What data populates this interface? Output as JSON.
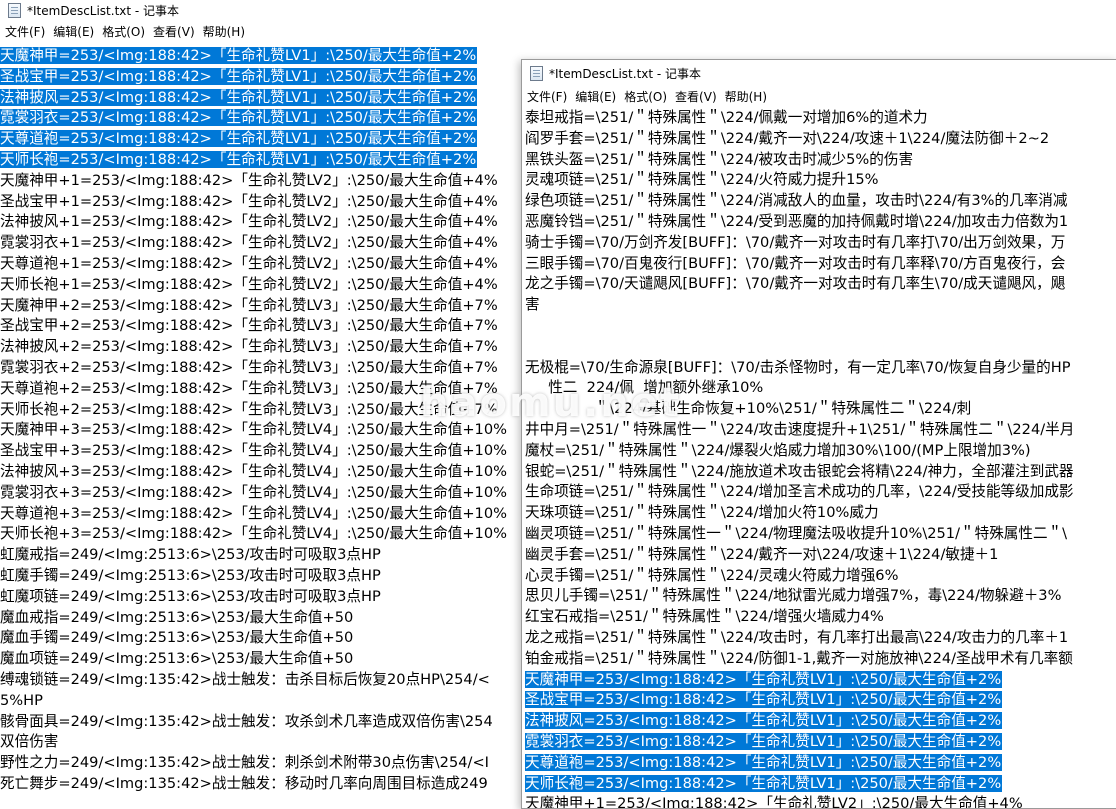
{
  "back_window": {
    "title": "*ItemDescList.txt - 记事本",
    "menu": [
      "文件(F)",
      "编辑(E)",
      "格式(O)",
      "查看(V)",
      "帮助(H)"
    ],
    "lines": [
      {
        "text": "天魔神甲=253/<Img:188:42>「生命礼赞LV1」:\\250/最大生命值+2%",
        "selected": true
      },
      {
        "text": "圣战宝甲=253/<Img:188:42>「生命礼赞LV1」:\\250/最大生命值+2%",
        "selected": true
      },
      {
        "text": "法神披风=253/<Img:188:42>「生命礼赞LV1」:\\250/最大生命值+2%",
        "selected": true
      },
      {
        "text": "霓裳羽衣=253/<Img:188:42>「生命礼赞LV1」:\\250/最大生命值+2%",
        "selected": true
      },
      {
        "text": "天尊道袍=253/<Img:188:42>「生命礼赞LV1」:\\250/最大生命值+2%",
        "selected": true
      },
      {
        "text": "天师长袍=253/<Img:188:42>「生命礼赞LV1」:\\250/最大生命值+2%",
        "selected": true
      },
      {
        "text": "天魔神甲+1=253/<Img:188:42>「生命礼赞LV2」:\\250/最大生命值+4%",
        "selected": false
      },
      {
        "text": "圣战宝甲+1=253/<Img:188:42>「生命礼赞LV2」:\\250/最大生命值+4%",
        "selected": false
      },
      {
        "text": "法神披风+1=253/<Img:188:42>「生命礼赞LV2」:\\250/最大生命值+4%",
        "selected": false
      },
      {
        "text": "霓裳羽衣+1=253/<Img:188:42>「生命礼赞LV2」:\\250/最大生命值+4%",
        "selected": false
      },
      {
        "text": "天尊道袍+1=253/<Img:188:42>「生命礼赞LV2」:\\250/最大生命值+4%",
        "selected": false
      },
      {
        "text": "天师长袍+1=253/<Img:188:42>「生命礼赞LV2」:\\250/最大生命值+4%",
        "selected": false
      },
      {
        "text": "天魔神甲+2=253/<Img:188:42>「生命礼赞LV3」:\\250/最大生命值+7%",
        "selected": false
      },
      {
        "text": "圣战宝甲+2=253/<Img:188:42>「生命礼赞LV3」:\\250/最大生命值+7%",
        "selected": false
      },
      {
        "text": "法神披风+2=253/<Img:188:42>「生命礼赞LV3」:\\250/最大生命值+7%",
        "selected": false
      },
      {
        "text": "霓裳羽衣+2=253/<Img:188:42>「生命礼赞LV3」:\\250/最大生命值+7%",
        "selected": false
      },
      {
        "text": "天尊道袍+2=253/<Img:188:42>「生命礼赞LV3」:\\250/最大生命值+7%",
        "selected": false
      },
      {
        "text": "天师长袍+2=253/<Img:188:42>「生命礼赞LV3」:\\250/最大生命值+7%",
        "selected": false
      },
      {
        "text": "天魔神甲+3=253/<Img:188:42>「生命礼赞LV4」:\\250/最大生命值+10%",
        "selected": false
      },
      {
        "text": "圣战宝甲+3=253/<Img:188:42>「生命礼赞LV4」:\\250/最大生命值+10%",
        "selected": false
      },
      {
        "text": "法神披风+3=253/<Img:188:42>「生命礼赞LV4」:\\250/最大生命值+10%",
        "selected": false
      },
      {
        "text": "霓裳羽衣+3=253/<Img:188:42>「生命礼赞LV4」:\\250/最大生命值+10%",
        "selected": false
      },
      {
        "text": "天尊道袍+3=253/<Img:188:42>「生命礼赞LV4」:\\250/最大生命值+10%",
        "selected": false
      },
      {
        "text": "天师长袍+3=253/<Img:188:42>「生命礼赞LV4」:\\250/最大生命值+10%",
        "selected": false
      },
      {
        "text": "虹魔戒指=249/<Img:2513:6>\\253/攻击时可吸取3点HP",
        "selected": false
      },
      {
        "text": "虹魔手镯=249/<Img:2513:6>\\253/攻击时可吸取3点HP",
        "selected": false
      },
      {
        "text": "虹魔项链=249/<Img:2513:6>\\253/攻击时可吸取3点HP",
        "selected": false
      },
      {
        "text": "魔血戒指=249/<Img:2513:6>\\253/最大生命值+50",
        "selected": false
      },
      {
        "text": "魔血手镯=249/<Img:2513:6>\\253/最大生命值+50",
        "selected": false
      },
      {
        "text": "魔血项链=249/<Img:2513:6>\\253/最大生命值+50",
        "selected": false
      },
      {
        "text": "缚魂锁链=249/<Img:135:42>战士触发：击杀目标后恢复20点HP\\254/<",
        "selected": false
      },
      {
        "text": "5%HP",
        "selected": false
      },
      {
        "text": "骸骨面具=249/<Img:135:42>战士触发：攻杀剑术几率造成双倍伤害\\254",
        "selected": false
      },
      {
        "text": "双倍伤害",
        "selected": false
      },
      {
        "text": "野性之力=249/<Img:135:42>战士触发：刺杀剑术附带30点伤害\\254/<I",
        "selected": false
      },
      {
        "text": "死亡舞步=249/<Img:135:42>战士触发：移动时几率向周围目标造成249",
        "selected": false
      }
    ]
  },
  "front_window": {
    "title": "*ItemDescList.txt - 记事本",
    "menu": [
      "文件(F)",
      "编辑(E)",
      "格式(O)",
      "查看(V)",
      "帮助(H)"
    ],
    "lines": [
      {
        "text": "泰坦戒指=\\251/＂特殊属性＂\\224/佩戴一对增加6%的道术力",
        "selected": false
      },
      {
        "text": "阎罗手套=\\251/＂特殊属性＂\\224/戴齐一对\\224/攻速＋1\\224/魔法防御＋2~2",
        "selected": false
      },
      {
        "text": "黑铁头盔=\\251/＂特殊属性＂\\224/被攻击时减少5%的伤害",
        "selected": false
      },
      {
        "text": "灵魂项链=\\251/＂特殊属性＂\\224/火符威力提升15%",
        "selected": false
      },
      {
        "text": "绿色项链=\\251/＂特殊属性＂\\224/消减敌人的血量，攻击时\\224/有3%的几率消减",
        "selected": false
      },
      {
        "text": "恶魔铃铛=\\251/＂特殊属性＂\\224/受到恶魔的加持佩戴时增\\224/加攻击力倍数为1",
        "selected": false
      },
      {
        "text": "骑士手镯=\\70/万剑齐发[BUFF]：\\70/戴齐一对攻击时有几率打\\70/出万剑效果，万",
        "selected": false
      },
      {
        "text": "三眼手镯=\\70/百鬼夜行[BUFF]：\\70/戴齐一对攻击时有几率释\\70/方百鬼夜行，会",
        "selected": false
      },
      {
        "text": "龙之手镯=\\70/天谴飓风[BUFF]：\\70/戴齐一对攻击时有几率生\\70/成天谴飓风，飓",
        "selected": false
      },
      {
        "text": "害",
        "selected": false
      },
      {
        "text": "",
        "selected": false
      },
      {
        "text": "",
        "selected": false
      },
      {
        "text": "无极棍=\\70/生命源泉[BUFF]：\\70/击杀怪物时，有一定几率\\70/恢复自身少量的HP",
        "selected": false
      },
      {
        "text": "     性二  224/佩  增加额外继承10%",
        "selected": false
      },
      {
        "text": "               ＂\\224/基础生命恢复+10%\\251/＂特殊属性二＂\\224/刺",
        "selected": false
      },
      {
        "text": "井中月=\\251/＂特殊属性一＂\\224/攻击速度提升+1\\251/＂特殊属性二＂\\224/半月",
        "selected": false
      },
      {
        "text": "魔杖=\\251/＂特殊属性＂\\224/爆裂火焰威力增加30%\\100/(MP上限增加3%)",
        "selected": false
      },
      {
        "text": "银蛇=\\251/＂特殊属性＂\\224/施放道术攻击银蛇会将精\\224/神力，全部灌注到武器",
        "selected": false
      },
      {
        "text": "生命项链=\\251/＂特殊属性＂\\224/增加圣言术成功的几率，\\224/受技能等级加成影",
        "selected": false
      },
      {
        "text": "天珠项链=\\251/＂特殊属性＂\\224/增加火符10%威力",
        "selected": false
      },
      {
        "text": "幽灵项链=\\251/＂特殊属性一＂\\224/物理魔法吸收提升10%\\251/＂特殊属性二＂\\",
        "selected": false
      },
      {
        "text": "幽灵手套=\\251/＂特殊属性＂\\224/戴齐一对\\224/攻速＋1\\224/敏捷＋1",
        "selected": false
      },
      {
        "text": "心灵手镯=\\251/＂特殊属性＂\\224/灵魂火符威力增强6%",
        "selected": false
      },
      {
        "text": "思贝儿手镯=\\251/＂特殊属性＂\\224/地狱雷光威力增强7%，毒\\224/物躲避＋3%",
        "selected": false
      },
      {
        "text": "红宝石戒指=\\251/＂特殊属性＂\\224/增强火墙威力4%",
        "selected": false
      },
      {
        "text": "龙之戒指=\\251/＂特殊属性＂\\224/攻击时，有几率打出最高\\224/攻击力的几率＋1",
        "selected": false
      },
      {
        "text": "铂金戒指=\\251/＂特殊属性＂\\224/防御1-1,戴齐一对施放神\\224/圣战甲术有几率额",
        "selected": false
      },
      {
        "text": "天魔神甲=253/<Img:188:42>「生命礼赞LV1」:\\250/最大生命值+2%",
        "selected": true
      },
      {
        "text": "圣战宝甲=253/<Img:188:42>「生命礼赞LV1」:\\250/最大生命值+2%",
        "selected": true
      },
      {
        "text": "法神披风=253/<Img:188:42>「生命礼赞LV1」:\\250/最大生命值+2%",
        "selected": true
      },
      {
        "text": "霓裳羽衣=253/<Img:188:42>「生命礼赞LV1」:\\250/最大生命值+2%",
        "selected": true
      },
      {
        "text": "天尊道袍=253/<Img:188:42>「生命礼赞LV1」:\\250/最大生命值+2%",
        "selected": true
      },
      {
        "text": "天师长袍=253/<Img:188:42>「生命礼赞LV1」:\\250/最大生命值+2%",
        "selected": true
      },
      {
        "text": "天魔神甲+1=253/<Img:188:42>「生命礼赞LV2」:\\250/最大生命值+4%",
        "selected": false
      }
    ]
  },
  "watermark": "haomu.net",
  "colors": {
    "selection": "#0078d7",
    "selection_text": "#ffffff"
  }
}
